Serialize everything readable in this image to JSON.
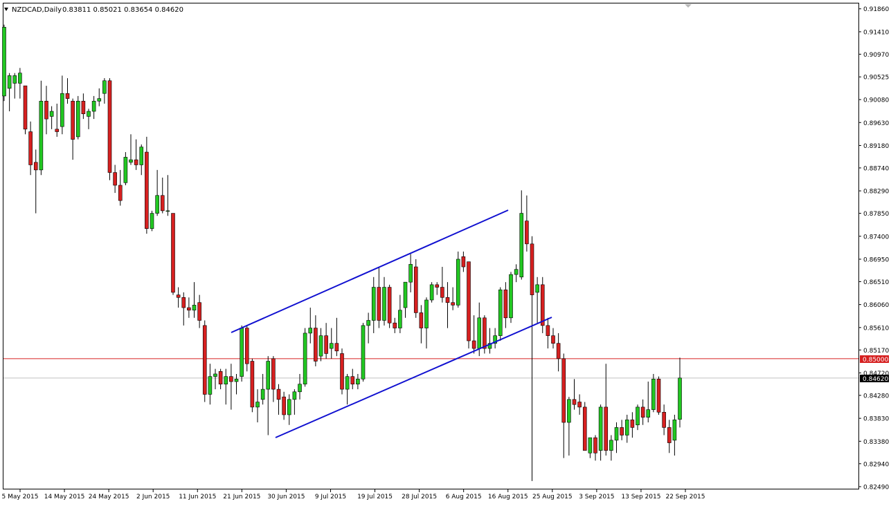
{
  "header": {
    "symbol": "NZDCAD,Daily",
    "ohlc": "0.83811 0.85021 0.83654 0.84620"
  },
  "colors": {
    "bull": "#22c722",
    "bear": "#d62020",
    "frame": "#000000",
    "channel": "#1010d0",
    "level": "#d62020",
    "current": "#000000"
  },
  "levels": {
    "resistance": "0.85000",
    "current_price": "0.84620"
  },
  "chart_data": {
    "type": "candlestick",
    "title": "NZDCAD,Daily",
    "ylim": [
      0.8249,
      0.9187
    ],
    "y_ticks": [
      "0.91860",
      "0.91410",
      "0.90970",
      "0.90525",
      "0.90080",
      "0.89630",
      "0.89180",
      "0.88740",
      "0.88290",
      "0.87850",
      "0.87400",
      "0.86950",
      "0.86510",
      "0.86060",
      "0.85610",
      "0.85170",
      "0.84720",
      "0.84280",
      "0.83830",
      "0.83380",
      "0.82940",
      "0.82490"
    ],
    "x_tick_labels": [
      "5 May 2015",
      "14 May 2015",
      "24 May 2015",
      "2 Jun 2015",
      "11 Jun 2015",
      "21 Jun 2015",
      "30 Jun 2015",
      "9 Jul 2015",
      "19 Jul 2015",
      "28 Jul 2015",
      "6 Aug 2015",
      "16 Aug 2015",
      "25 Aug 2015",
      "3 Sep 2015",
      "13 Sep 2015",
      "22 Sep 2015"
    ],
    "candles": [
      {
        "o": 0.9015,
        "h": 0.9155,
        "l": 0.9005,
        "c": 0.915
      },
      {
        "o": 0.903,
        "h": 0.906,
        "l": 0.8985,
        "c": 0.9055
      },
      {
        "o": 0.904,
        "h": 0.906,
        "l": 0.901,
        "c": 0.9055
      },
      {
        "o": 0.904,
        "h": 0.907,
        "l": 0.901,
        "c": 0.906
      },
      {
        "o": 0.9035,
        "h": 0.9035,
        "l": 0.894,
        "c": 0.895
      },
      {
        "o": 0.8945,
        "h": 0.8965,
        "l": 0.886,
        "c": 0.888
      },
      {
        "o": 0.8885,
        "h": 0.891,
        "l": 0.8785,
        "c": 0.887
      },
      {
        "o": 0.887,
        "h": 0.9045,
        "l": 0.886,
        "c": 0.9005
      },
      {
        "o": 0.9005,
        "h": 0.9035,
        "l": 0.894,
        "c": 0.897
      },
      {
        "o": 0.8975,
        "h": 0.8995,
        "l": 0.895,
        "c": 0.8985
      },
      {
        "o": 0.895,
        "h": 0.9,
        "l": 0.8935,
        "c": 0.8945
      },
      {
        "o": 0.8955,
        "h": 0.9055,
        "l": 0.894,
        "c": 0.902
      },
      {
        "o": 0.902,
        "h": 0.905,
        "l": 0.9,
        "c": 0.901
      },
      {
        "o": 0.9005,
        "h": 0.901,
        "l": 0.889,
        "c": 0.893
      },
      {
        "o": 0.8935,
        "h": 0.9015,
        "l": 0.893,
        "c": 0.9005
      },
      {
        "o": 0.9005,
        "h": 0.902,
        "l": 0.897,
        "c": 0.898
      },
      {
        "o": 0.8975,
        "h": 0.899,
        "l": 0.895,
        "c": 0.8985
      },
      {
        "o": 0.8985,
        "h": 0.9015,
        "l": 0.897,
        "c": 0.9005
      },
      {
        "o": 0.9005,
        "h": 0.903,
        "l": 0.8995,
        "c": 0.901
      },
      {
        "o": 0.902,
        "h": 0.905,
        "l": 0.9,
        "c": 0.9045
      },
      {
        "o": 0.9045,
        "h": 0.905,
        "l": 0.885,
        "c": 0.8865
      },
      {
        "o": 0.8865,
        "h": 0.888,
        "l": 0.8825,
        "c": 0.884
      },
      {
        "o": 0.884,
        "h": 0.887,
        "l": 0.88,
        "c": 0.881
      },
      {
        "o": 0.8845,
        "h": 0.8905,
        "l": 0.884,
        "c": 0.8895
      },
      {
        "o": 0.8885,
        "h": 0.894,
        "l": 0.888,
        "c": 0.889
      },
      {
        "o": 0.889,
        "h": 0.893,
        "l": 0.887,
        "c": 0.888
      },
      {
        "o": 0.888,
        "h": 0.892,
        "l": 0.886,
        "c": 0.8915
      },
      {
        "o": 0.8905,
        "h": 0.8935,
        "l": 0.8745,
        "c": 0.8755
      },
      {
        "o": 0.8755,
        "h": 0.879,
        "l": 0.875,
        "c": 0.8785
      },
      {
        "o": 0.8785,
        "h": 0.887,
        "l": 0.878,
        "c": 0.882
      },
      {
        "o": 0.882,
        "h": 0.8855,
        "l": 0.8785,
        "c": 0.879
      },
      {
        "o": 0.879,
        "h": 0.886,
        "l": 0.878,
        "c": 0.879
      },
      {
        "o": 0.8785,
        "h": 0.8785,
        "l": 0.8625,
        "c": 0.863
      },
      {
        "o": 0.8625,
        "h": 0.864,
        "l": 0.86,
        "c": 0.862
      },
      {
        "o": 0.862,
        "h": 0.863,
        "l": 0.8565,
        "c": 0.86
      },
      {
        "o": 0.86,
        "h": 0.862,
        "l": 0.858,
        "c": 0.8595
      },
      {
        "o": 0.8595,
        "h": 0.865,
        "l": 0.858,
        "c": 0.8605
      },
      {
        "o": 0.861,
        "h": 0.8625,
        "l": 0.856,
        "c": 0.8575
      },
      {
        "o": 0.8565,
        "h": 0.8575,
        "l": 0.8415,
        "c": 0.843
      },
      {
        "o": 0.843,
        "h": 0.849,
        "l": 0.841,
        "c": 0.8465
      },
      {
        "o": 0.8465,
        "h": 0.848,
        "l": 0.844,
        "c": 0.847
      },
      {
        "o": 0.8475,
        "h": 0.848,
        "l": 0.844,
        "c": 0.845
      },
      {
        "o": 0.845,
        "h": 0.848,
        "l": 0.841,
        "c": 0.8465
      },
      {
        "o": 0.8465,
        "h": 0.849,
        "l": 0.84,
        "c": 0.8455
      },
      {
        "o": 0.8455,
        "h": 0.847,
        "l": 0.843,
        "c": 0.846
      },
      {
        "o": 0.8465,
        "h": 0.8565,
        "l": 0.8455,
        "c": 0.856
      },
      {
        "o": 0.856,
        "h": 0.8565,
        "l": 0.8475,
        "c": 0.849
      },
      {
        "o": 0.8495,
        "h": 0.85,
        "l": 0.8395,
        "c": 0.8405
      },
      {
        "o": 0.8405,
        "h": 0.844,
        "l": 0.8375,
        "c": 0.8415
      },
      {
        "o": 0.842,
        "h": 0.847,
        "l": 0.841,
        "c": 0.844
      },
      {
        "o": 0.844,
        "h": 0.8505,
        "l": 0.835,
        "c": 0.8495
      },
      {
        "o": 0.85,
        "h": 0.8505,
        "l": 0.8415,
        "c": 0.844
      },
      {
        "o": 0.844,
        "h": 0.845,
        "l": 0.839,
        "c": 0.842
      },
      {
        "o": 0.8425,
        "h": 0.8435,
        "l": 0.838,
        "c": 0.839
      },
      {
        "o": 0.839,
        "h": 0.843,
        "l": 0.837,
        "c": 0.842
      },
      {
        "o": 0.842,
        "h": 0.844,
        "l": 0.839,
        "c": 0.8435
      },
      {
        "o": 0.8435,
        "h": 0.847,
        "l": 0.842,
        "c": 0.845
      },
      {
        "o": 0.845,
        "h": 0.856,
        "l": 0.8445,
        "c": 0.855
      },
      {
        "o": 0.855,
        "h": 0.86,
        "l": 0.853,
        "c": 0.856
      },
      {
        "o": 0.856,
        "h": 0.8585,
        "l": 0.8485,
        "c": 0.8495
      },
      {
        "o": 0.8505,
        "h": 0.856,
        "l": 0.8495,
        "c": 0.8545
      },
      {
        "o": 0.8545,
        "h": 0.857,
        "l": 0.85,
        "c": 0.851
      },
      {
        "o": 0.852,
        "h": 0.856,
        "l": 0.85,
        "c": 0.853
      },
      {
        "o": 0.853,
        "h": 0.858,
        "l": 0.8505,
        "c": 0.8515
      },
      {
        "o": 0.851,
        "h": 0.852,
        "l": 0.843,
        "c": 0.844
      },
      {
        "o": 0.844,
        "h": 0.847,
        "l": 0.841,
        "c": 0.8465
      },
      {
        "o": 0.8465,
        "h": 0.848,
        "l": 0.844,
        "c": 0.845
      },
      {
        "o": 0.845,
        "h": 0.847,
        "l": 0.844,
        "c": 0.846
      },
      {
        "o": 0.846,
        "h": 0.857,
        "l": 0.8455,
        "c": 0.8565
      },
      {
        "o": 0.8565,
        "h": 0.859,
        "l": 0.853,
        "c": 0.8575
      },
      {
        "o": 0.8575,
        "h": 0.866,
        "l": 0.855,
        "c": 0.864
      },
      {
        "o": 0.864,
        "h": 0.868,
        "l": 0.856,
        "c": 0.8575
      },
      {
        "o": 0.8575,
        "h": 0.866,
        "l": 0.8565,
        "c": 0.864
      },
      {
        "o": 0.864,
        "h": 0.8645,
        "l": 0.856,
        "c": 0.857
      },
      {
        "o": 0.857,
        "h": 0.858,
        "l": 0.855,
        "c": 0.856
      },
      {
        "o": 0.856,
        "h": 0.8625,
        "l": 0.855,
        "c": 0.8595
      },
      {
        "o": 0.86,
        "h": 0.865,
        "l": 0.858,
        "c": 0.865
      },
      {
        "o": 0.865,
        "h": 0.8705,
        "l": 0.863,
        "c": 0.8685
      },
      {
        "o": 0.868,
        "h": 0.8695,
        "l": 0.858,
        "c": 0.859
      },
      {
        "o": 0.859,
        "h": 0.8605,
        "l": 0.853,
        "c": 0.856
      },
      {
        "o": 0.856,
        "h": 0.862,
        "l": 0.852,
        "c": 0.8615
      },
      {
        "o": 0.8615,
        "h": 0.865,
        "l": 0.861,
        "c": 0.8645
      },
      {
        "o": 0.8645,
        "h": 0.865,
        "l": 0.8625,
        "c": 0.864
      },
      {
        "o": 0.864,
        "h": 0.868,
        "l": 0.861,
        "c": 0.862
      },
      {
        "o": 0.862,
        "h": 0.865,
        "l": 0.856,
        "c": 0.861
      },
      {
        "o": 0.861,
        "h": 0.864,
        "l": 0.8595,
        "c": 0.8605
      },
      {
        "o": 0.8605,
        "h": 0.871,
        "l": 0.86,
        "c": 0.8695
      },
      {
        "o": 0.87,
        "h": 0.871,
        "l": 0.867,
        "c": 0.868
      },
      {
        "o": 0.869,
        "h": 0.869,
        "l": 0.852,
        "c": 0.8535
      },
      {
        "o": 0.8535,
        "h": 0.8585,
        "l": 0.851,
        "c": 0.852
      },
      {
        "o": 0.852,
        "h": 0.861,
        "l": 0.8505,
        "c": 0.858
      },
      {
        "o": 0.858,
        "h": 0.8585,
        "l": 0.851,
        "c": 0.852
      },
      {
        "o": 0.852,
        "h": 0.856,
        "l": 0.851,
        "c": 0.853
      },
      {
        "o": 0.853,
        "h": 0.856,
        "l": 0.852,
        "c": 0.8545
      },
      {
        "o": 0.8545,
        "h": 0.864,
        "l": 0.8535,
        "c": 0.8635
      },
      {
        "o": 0.8635,
        "h": 0.865,
        "l": 0.856,
        "c": 0.858
      },
      {
        "o": 0.858,
        "h": 0.867,
        "l": 0.857,
        "c": 0.8665
      },
      {
        "o": 0.8665,
        "h": 0.8685,
        "l": 0.865,
        "c": 0.8675
      },
      {
        "o": 0.866,
        "h": 0.883,
        "l": 0.8655,
        "c": 0.8785
      },
      {
        "o": 0.877,
        "h": 0.882,
        "l": 0.871,
        "c": 0.8725
      },
      {
        "o": 0.8725,
        "h": 0.874,
        "l": 0.826,
        "c": 0.8625
      },
      {
        "o": 0.863,
        "h": 0.866,
        "l": 0.857,
        "c": 0.8645
      },
      {
        "o": 0.8645,
        "h": 0.866,
        "l": 0.855,
        "c": 0.8565
      },
      {
        "o": 0.8565,
        "h": 0.858,
        "l": 0.852,
        "c": 0.8545
      },
      {
        "o": 0.8545,
        "h": 0.856,
        "l": 0.852,
        "c": 0.853
      },
      {
        "o": 0.853,
        "h": 0.855,
        "l": 0.8475,
        "c": 0.85
      },
      {
        "o": 0.85,
        "h": 0.851,
        "l": 0.8305,
        "c": 0.8375
      },
      {
        "o": 0.8375,
        "h": 0.8425,
        "l": 0.831,
        "c": 0.842
      },
      {
        "o": 0.842,
        "h": 0.846,
        "l": 0.84,
        "c": 0.841
      },
      {
        "o": 0.8415,
        "h": 0.843,
        "l": 0.839,
        "c": 0.8405
      },
      {
        "o": 0.8405,
        "h": 0.8415,
        "l": 0.833,
        "c": 0.832
      },
      {
        "o": 0.8315,
        "h": 0.8345,
        "l": 0.8305,
        "c": 0.8345
      },
      {
        "o": 0.8345,
        "h": 0.835,
        "l": 0.83,
        "c": 0.8315
      },
      {
        "o": 0.832,
        "h": 0.841,
        "l": 0.83,
        "c": 0.8405
      },
      {
        "o": 0.8405,
        "h": 0.849,
        "l": 0.831,
        "c": 0.832
      },
      {
        "o": 0.832,
        "h": 0.835,
        "l": 0.83,
        "c": 0.834
      },
      {
        "o": 0.834,
        "h": 0.8375,
        "l": 0.8315,
        "c": 0.8365
      },
      {
        "o": 0.8365,
        "h": 0.838,
        "l": 0.834,
        "c": 0.835
      },
      {
        "o": 0.835,
        "h": 0.839,
        "l": 0.8335,
        "c": 0.838
      },
      {
        "o": 0.838,
        "h": 0.8395,
        "l": 0.8345,
        "c": 0.8365
      },
      {
        "o": 0.837,
        "h": 0.841,
        "l": 0.836,
        "c": 0.8405
      },
      {
        "o": 0.8405,
        "h": 0.842,
        "l": 0.837,
        "c": 0.8385
      },
      {
        "o": 0.8385,
        "h": 0.8455,
        "l": 0.8375,
        "c": 0.84
      },
      {
        "o": 0.84,
        "h": 0.847,
        "l": 0.8395,
        "c": 0.846
      },
      {
        "o": 0.846,
        "h": 0.8465,
        "l": 0.839,
        "c": 0.8395
      },
      {
        "o": 0.8395,
        "h": 0.841,
        "l": 0.835,
        "c": 0.8365
      },
      {
        "o": 0.8365,
        "h": 0.838,
        "l": 0.8315,
        "c": 0.8335
      },
      {
        "o": 0.834,
        "h": 0.839,
        "l": 0.831,
        "c": 0.838
      },
      {
        "o": 0.8381,
        "h": 0.8502,
        "l": 0.8365,
        "c": 0.8462
      }
    ]
  }
}
